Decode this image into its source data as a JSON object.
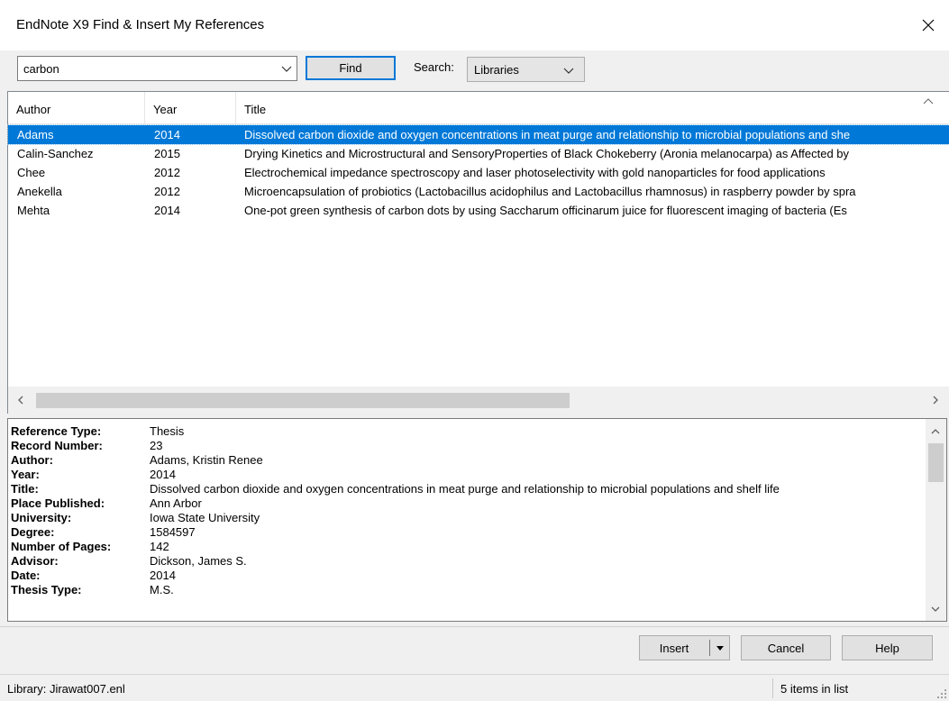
{
  "window": {
    "title": "EndNote X9 Find & Insert My References"
  },
  "toolbar": {
    "search_value": "carbon",
    "find_label": "Find",
    "search_label": "Search:",
    "scope_value": "Libraries"
  },
  "list": {
    "columns": [
      "Author",
      "Year",
      "Title"
    ],
    "rows": [
      {
        "author": "Adams",
        "year": "2014",
        "title": "Dissolved carbon dioxide and oxygen concentrations in meat purge and relationship to microbial populations and she"
      },
      {
        "author": "Calin-Sanchez",
        "year": "2015",
        "title": "Drying Kinetics and Microstructural and SensoryProperties of Black Chokeberry (Aronia melanocarpa) as Affected by"
      },
      {
        "author": "Chee",
        "year": "2012",
        "title": "Electrochemical impedance spectroscopy and laser photoselectivity with gold nanoparticles for food applications"
      },
      {
        "author": "Anekella",
        "year": "2012",
        "title": "Microencapsulation of probiotics (Lactobacillus acidophilus and Lactobacillus rhamnosus) in raspberry powder by spra"
      },
      {
        "author": "Mehta",
        "year": "2014",
        "title": "One-pot green synthesis of carbon dots by using Saccharum officinarum juice for fluorescent imaging of bacteria (Es"
      }
    ]
  },
  "detail": {
    "fields": [
      {
        "label": "Reference Type:",
        "value": "Thesis"
      },
      {
        "label": "Record Number:",
        "value": "23"
      },
      {
        "label": "Author:",
        "value": "Adams, Kristin Renee"
      },
      {
        "label": "Year:",
        "value": "2014"
      },
      {
        "label": "Title:",
        "value": "Dissolved carbon dioxide and oxygen concentrations in meat purge and relationship to microbial populations and shelf life"
      },
      {
        "label": "Place Published:",
        "value": "Ann Arbor"
      },
      {
        "label": "University:",
        "value": "Iowa State University"
      },
      {
        "label": "Degree:",
        "value": "1584597"
      },
      {
        "label": "Number of Pages:",
        "value": "142"
      },
      {
        "label": "Advisor:",
        "value": "Dickson, James S."
      },
      {
        "label": "Date:",
        "value": "2014"
      },
      {
        "label": "Thesis Type:",
        "value": "M.S."
      }
    ]
  },
  "buttons": {
    "insert_label": "Insert",
    "cancel_label": "Cancel",
    "help_label": "Help"
  },
  "status": {
    "library": "Library: Jirawat007.enl",
    "count": "5 items in list"
  },
  "colors": {
    "selection": "#0078d7",
    "focus_border": "#0078d7"
  }
}
